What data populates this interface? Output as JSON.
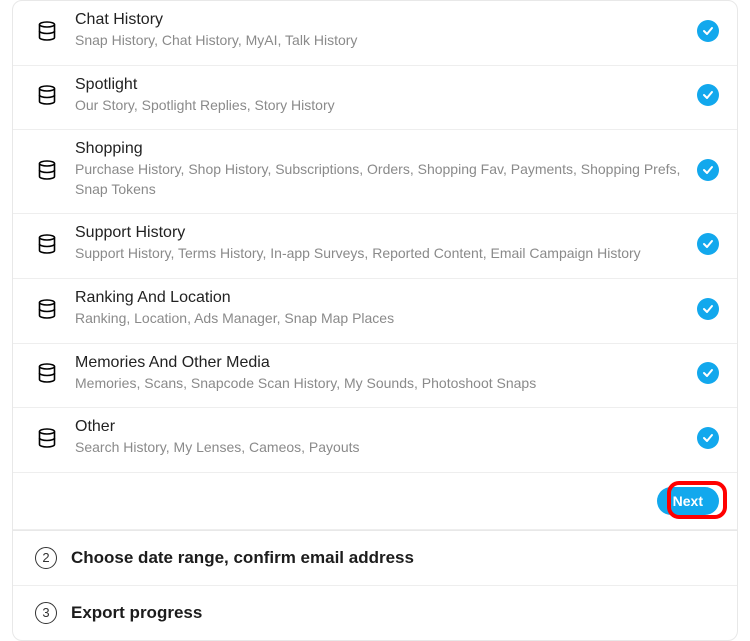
{
  "categories": [
    {
      "title": "Chat History",
      "subtitle": "Snap History, Chat History, MyAI, Talk History",
      "checked": true
    },
    {
      "title": "Spotlight",
      "subtitle": "Our Story, Spotlight Replies, Story History",
      "checked": true
    },
    {
      "title": "Shopping",
      "subtitle": "Purchase History, Shop History, Subscriptions, Orders, Shopping Fav, Payments, Shopping Prefs, Snap Tokens",
      "checked": true
    },
    {
      "title": "Support History",
      "subtitle": "Support History, Terms History, In-app Surveys, Reported Content, Email Campaign History",
      "checked": true
    },
    {
      "title": "Ranking And Location",
      "subtitle": "Ranking, Location, Ads Manager, Snap Map Places",
      "checked": true
    },
    {
      "title": "Memories And Other Media",
      "subtitle": "Memories, Scans, Snapcode Scan History, My Sounds, Photoshoot Snaps",
      "checked": true
    },
    {
      "title": "Other",
      "subtitle": "Search History, My Lenses, Cameos, Payouts",
      "checked": true
    }
  ],
  "next_button_label": "Next",
  "steps": [
    {
      "num": "2",
      "label": "Choose date range, confirm email address"
    },
    {
      "num": "3",
      "label": "Export progress"
    }
  ]
}
